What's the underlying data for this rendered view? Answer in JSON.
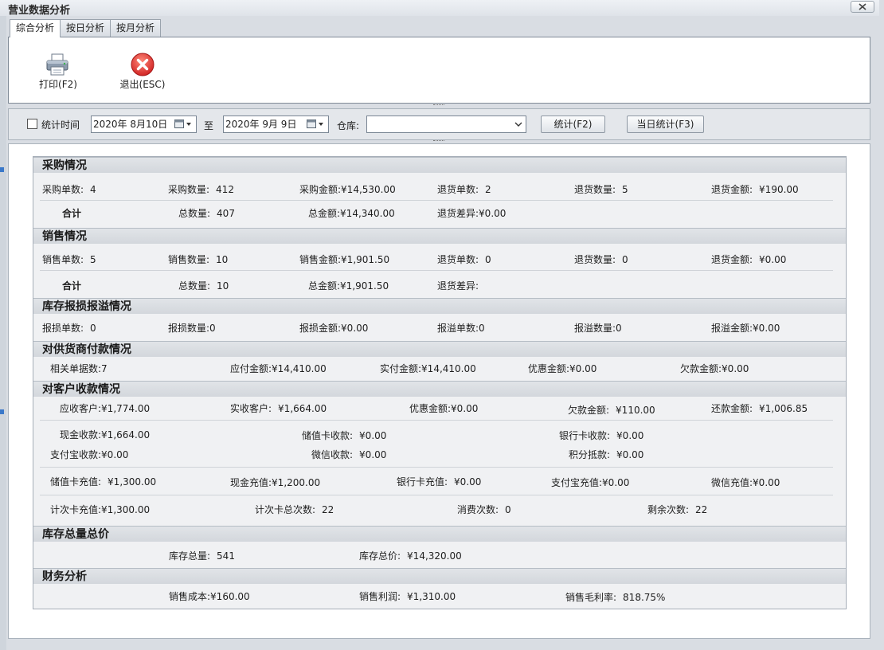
{
  "window": {
    "title": "营业数据分析"
  },
  "tabs": [
    {
      "label": "综合分析",
      "active": true
    },
    {
      "label": "按日分析",
      "active": false
    },
    {
      "label": "按月分析",
      "active": false
    }
  ],
  "toolbar": {
    "print_label": "打印(F2)",
    "exit_label": "退出(ESC)"
  },
  "filter": {
    "time_label": "统计时间",
    "start_date": "2020年  8月10日",
    "to_label": "至",
    "end_date": "2020年  9月  9日",
    "warehouse_label": "仓库:",
    "warehouse_value": "",
    "stat_button": "统计(F2)",
    "today_button": "当日统计(F3)"
  },
  "purchase": {
    "title": "采购情况",
    "row1": [
      {
        "label": "采购单数:",
        "value": "4"
      },
      {
        "label": "采购数量:",
        "value": "412"
      },
      {
        "label": "采购金额:",
        "value": "¥14,530.00"
      },
      {
        "label": "退货单数:",
        "value": "2"
      },
      {
        "label": "退货数量:",
        "value": "5"
      },
      {
        "label": "退货金额:",
        "value": "¥190.00"
      }
    ],
    "total_label": "合计",
    "row2": [
      {
        "label": "总数量:",
        "value": "407"
      },
      {
        "label": "总金额:",
        "value": "¥14,340.00"
      },
      {
        "label": "退货差异:",
        "value": "¥0.00"
      }
    ]
  },
  "sales": {
    "title": "销售情况",
    "row1": [
      {
        "label": "销售单数:",
        "value": "5"
      },
      {
        "label": "销售数量:",
        "value": "10"
      },
      {
        "label": "销售金额:",
        "value": "¥1,901.50"
      },
      {
        "label": "退货单数:",
        "value": "0"
      },
      {
        "label": "退货数量:",
        "value": "0"
      },
      {
        "label": "退货金额:",
        "value": "¥0.00"
      }
    ],
    "total_label": "合计",
    "row2": [
      {
        "label": "总数量:",
        "value": "10"
      },
      {
        "label": "总金额:",
        "value": "¥1,901.50"
      },
      {
        "label": "退货差异:",
        "value": ""
      }
    ]
  },
  "loss": {
    "title": "库存报损报溢情况",
    "row1": [
      {
        "label": "报损单数:",
        "value": "0"
      },
      {
        "label": "报损数量:",
        "value": "0"
      },
      {
        "label": "报损金额:",
        "value": "¥0.00"
      },
      {
        "label": "报溢单数:",
        "value": "0"
      },
      {
        "label": "报溢数量:",
        "value": "0"
      },
      {
        "label": "报溢金额:",
        "value": "¥0.00"
      }
    ]
  },
  "supplier": {
    "title": "对供货商付款情况",
    "row1": [
      {
        "label": "相关单据数:",
        "value": "7"
      },
      {
        "label": "应付金额:",
        "value": "¥14,410.00"
      },
      {
        "label": "实付金额:",
        "value": "¥14,410.00"
      },
      {
        "label": "优惠金额:",
        "value": "¥0.00"
      },
      {
        "label": "欠款金额:",
        "value": "¥0.00"
      }
    ]
  },
  "customer": {
    "title": "对客户收款情况",
    "row1": [
      {
        "label": "应收客户:",
        "value": "¥1,774.00"
      },
      {
        "label": "实收客户:",
        "value": "¥1,664.00"
      },
      {
        "label": "优惠金额:",
        "value": "¥0.00"
      },
      {
        "label": "欠款金额:",
        "value": "¥110.00"
      },
      {
        "label": "还款金额:",
        "value": "¥1,006.85"
      }
    ],
    "row2": [
      {
        "label": "现金收款:",
        "value": "¥1,664.00"
      },
      {
        "label": "储值卡收款:",
        "value": "¥0.00"
      },
      {
        "label": "银行卡收款:",
        "value": "¥0.00"
      }
    ],
    "row3": [
      {
        "label": "支付宝收款:",
        "value": "¥0.00"
      },
      {
        "label": "微信收款:",
        "value": "¥0.00"
      },
      {
        "label": "积分抵款:",
        "value": "¥0.00"
      }
    ],
    "row4": [
      {
        "label": "储值卡充值:",
        "value": "¥1,300.00"
      },
      {
        "label": "现金充值:",
        "value": "¥1,200.00"
      },
      {
        "label": "银行卡充值:",
        "value": "¥0.00"
      },
      {
        "label": "支付宝充值:",
        "value": "¥0.00"
      },
      {
        "label": "微信充值:",
        "value": "¥0.00"
      }
    ],
    "row5": [
      {
        "label": "计次卡充值:",
        "value": "¥1,300.00"
      },
      {
        "label": "计次卡总次数:",
        "value": "22"
      },
      {
        "label": "消费次数:",
        "value": "0"
      },
      {
        "label": "剩余次数:",
        "value": "22"
      }
    ]
  },
  "stock": {
    "title": "库存总量总价",
    "row1": [
      {
        "label": "库存总量:",
        "value": "541"
      },
      {
        "label": "库存总价:",
        "value": "¥14,320.00"
      }
    ]
  },
  "finance": {
    "title": "财务分析",
    "row1": [
      {
        "label": "销售成本:",
        "value": "¥160.00"
      },
      {
        "label": "销售利润:",
        "value": "¥1,310.00"
      },
      {
        "label": "销售毛利率:",
        "value": "818.75%"
      }
    ]
  },
  "colors": {
    "exit_icon": "#e03434",
    "header_bg": "#d9dde3"
  },
  "icons": {
    "print": "printer-icon",
    "exit": "close-circle-icon"
  }
}
